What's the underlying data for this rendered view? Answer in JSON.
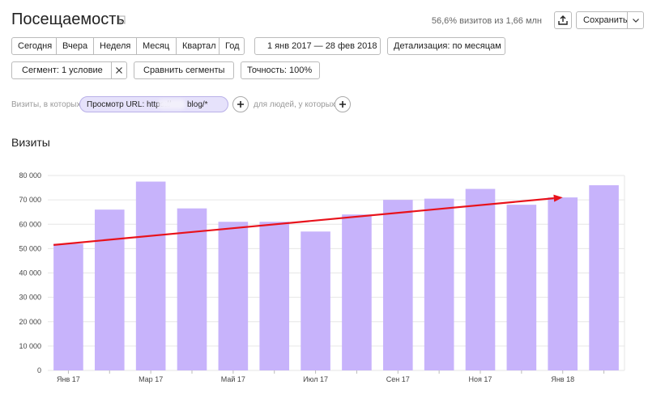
{
  "header": {
    "title": "Посещаемость",
    "visits_stat": "56,6% визитов из 1,66 млн",
    "save_label": "Сохранить"
  },
  "period_buttons": [
    "Сегодня",
    "Вчера",
    "Неделя",
    "Месяц",
    "Квартал",
    "Год"
  ],
  "date_range": "1 янв 2017 — 28 фев 2018",
  "detail_label": "Детализация: по месяцам",
  "segment_label": "Сегмент: 1 условие",
  "compare_label": "Сравнить сегменты",
  "accuracy_label": "Точность: 100%",
  "conditions": {
    "prefix": "Визиты, в которых",
    "chip": "Просмотр URL: https://",
    "chip_tail": "blog/*",
    "people": "для людей, у которых"
  },
  "section_title": "Визиты",
  "colors": {
    "bar": "#c7b3fb",
    "arrow": "#e8121b",
    "grid": "#e6e6e6"
  },
  "chart_data": {
    "type": "bar",
    "categories": [
      "2017-01",
      "2017-02",
      "2017-03",
      "2017-04",
      "2017-05",
      "2017-06",
      "2017-07",
      "2017-08",
      "2017-09",
      "2017-10",
      "2017-11",
      "2017-12",
      "2018-01",
      "2018-02"
    ],
    "values": [
      52000,
      66000,
      77500,
      66500,
      61000,
      61000,
      57000,
      64000,
      70000,
      70500,
      74500,
      68000,
      71000,
      76000
    ],
    "ylim": [
      0,
      80000
    ],
    "yticks": [
      0,
      10000,
      20000,
      30000,
      40000,
      50000,
      60000,
      70000,
      80000
    ],
    "ytick_labels": [
      "0",
      "10 000",
      "20 000",
      "30 000",
      "40 000",
      "50 000",
      "60 000",
      "70 000",
      "80 000"
    ],
    "xtick_labels": [
      "Янв 17",
      "",
      "Мар 17",
      "",
      "Май 17",
      "",
      "Июл 17",
      "",
      "Сен 17",
      "",
      "Ноя 17",
      "",
      "Янв 18",
      ""
    ],
    "trend_arrow": {
      "from": [
        "2017-01",
        51500
      ],
      "to": [
        "2018-01",
        71000
      ]
    },
    "grid": true
  }
}
